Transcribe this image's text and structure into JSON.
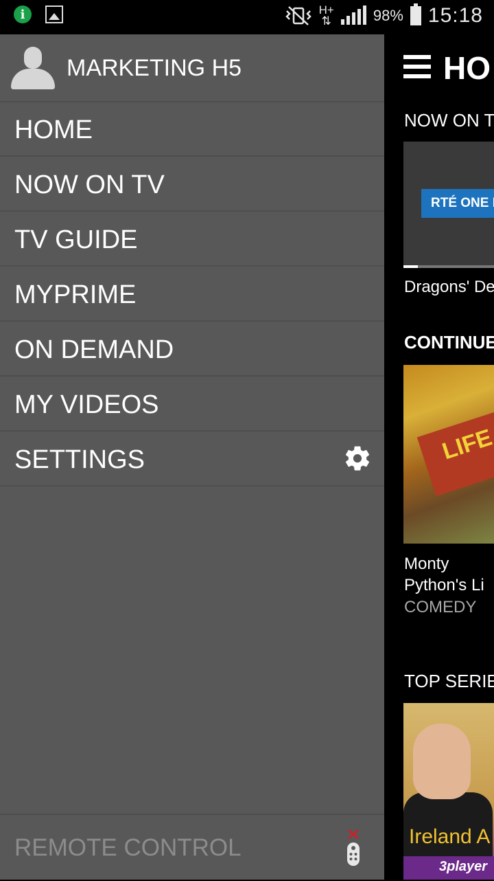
{
  "status_bar": {
    "left_icons": [
      "info-icon",
      "gallery-icon"
    ],
    "right_icons": [
      "vibrate-icon",
      "network-hplus-icon",
      "signal-icon",
      "battery-icon"
    ],
    "network_type": "H+",
    "battery_percent": "98%",
    "time": "15:18"
  },
  "drawer": {
    "username": "MARKETING H5",
    "menu_items": [
      {
        "label": "HOME"
      },
      {
        "label": "NOW ON TV"
      },
      {
        "label": "TV GUIDE"
      },
      {
        "label": "MYPRIME"
      },
      {
        "label": "ON DEMAND"
      },
      {
        "label": "MY VIDEOS"
      },
      {
        "label": "SETTINGS",
        "icon": "gear-icon"
      }
    ],
    "remote_control_label": "REMOTE CONTROL",
    "remote_icon": "remote-disconnected-icon",
    "accent_color": "#585858"
  },
  "main": {
    "title": "HO",
    "sections": [
      {
        "title": "NOW ON T",
        "channel_badge": "RTÉ ONE HD",
        "program": "Dragons' De",
        "progress": 0.13
      },
      {
        "title": "CONTINUE",
        "item_title": "Monty Python's Li",
        "item_title_line1": "Monty",
        "item_title_line2": "Python's Li",
        "genre": "COMEDY",
        "poster_text": "LIFE OF BRIAN"
      },
      {
        "title": "TOP SERIE",
        "poster_text": "Ireland A",
        "badge": "3player"
      }
    ]
  }
}
